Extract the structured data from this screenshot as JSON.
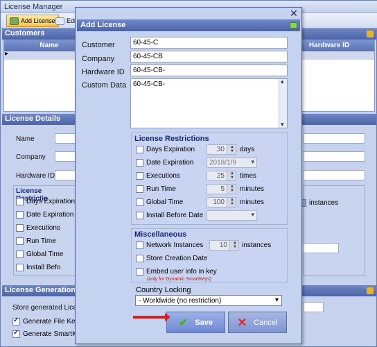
{
  "lm": {
    "title": "License Manager",
    "toolbar": {
      "add_license": "Add License",
      "edit_partial": "Edi"
    },
    "customers_header": "Customers",
    "columns": [
      "Name",
      "Hardware ID"
    ],
    "details_header": "License Details",
    "details_labels": {
      "name": "Name",
      "company": "Company",
      "hardware_id": "Hardware ID"
    },
    "restrictions_title": "License Restrictio",
    "restrictions": [
      "Days Expiration",
      "Date Expiration",
      "Executions",
      "Run Time",
      "Global Time",
      "Install Befo"
    ],
    "instances_label": "instances",
    "generation_header": "License Generation",
    "store_label": "Store generated License",
    "generate_file_key": "Generate File Key",
    "generate_smartkey": "Generate SmartKey"
  },
  "dialog": {
    "title": "Add License",
    "fields": {
      "customer_label": "Customer",
      "customer_value": "60-45-C",
      "company_label": "Company",
      "company_value": "60-45-CB",
      "hardware_label": "Hardware ID",
      "hardware_value": "60-45-CB-",
      "custom_label": "Custom Data",
      "custom_value": "60-45-CB-"
    },
    "restrictions": {
      "title": "License Restrictions",
      "days_label": "Days Expiration",
      "days_value": "30",
      "days_unit": "days",
      "date_label": "Date Expiration",
      "date_value": "2018/1/9",
      "exec_label": "Executions",
      "exec_value": "25",
      "exec_unit": "times",
      "run_label": "Run Time",
      "run_value": "5",
      "run_unit": "minutes",
      "global_label": "Global Time",
      "global_value": "100",
      "global_unit": "minutes",
      "install_label": "Install Before Date"
    },
    "misc": {
      "title": "Miscellaneous",
      "network_label": "Network Instances",
      "network_value": "10",
      "network_unit": "instances",
      "store_label": "Store Creation Date",
      "embed_label": "Embed user info in key",
      "embed_hint": "(only for Dynamic SmartKeys)"
    },
    "country": {
      "label": "Country Locking",
      "value": "- Worldwide (no restriction)"
    },
    "buttons": {
      "save": "Save",
      "cancel": "Cancel"
    }
  }
}
